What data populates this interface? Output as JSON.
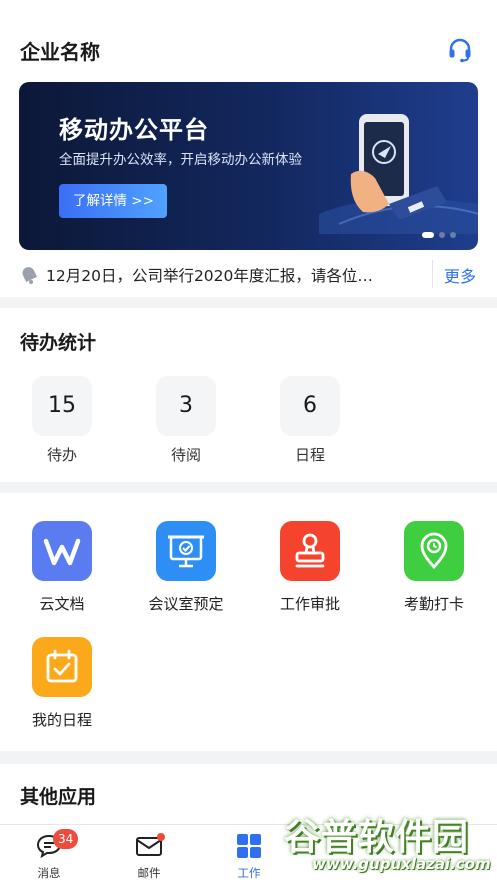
{
  "header": {
    "title": "企业名称",
    "support_icon": "headset-icon"
  },
  "banner": {
    "title": "移动办公平台",
    "subtitle": "全面提升办公效率，开启移动办公新体验",
    "button_label": "了解详情 >>",
    "slide_count": 3,
    "active_slide": 1
  },
  "notice": {
    "text": "12月20日，公司举行2020年度汇报，请各位…",
    "more_label": "更多",
    "icon": "bell-icon"
  },
  "todo": {
    "title": "待办统计",
    "items": [
      {
        "value": "15",
        "label": "待办"
      },
      {
        "value": "3",
        "label": "待阅"
      },
      {
        "value": "6",
        "label": "日程"
      }
    ]
  },
  "apps": [
    {
      "label": "云文档",
      "icon": "wps-icon",
      "color": "#5b7cf0"
    },
    {
      "label": "会议室预定",
      "icon": "meeting-room-icon",
      "color": "#2d8ff5"
    },
    {
      "label": "工作审批",
      "icon": "stamp-icon",
      "color": "#f5442d"
    },
    {
      "label": "考勤打卡",
      "icon": "location-clock-icon",
      "color": "#3fce3f"
    },
    {
      "label": "我的日程",
      "icon": "calendar-icon",
      "color": "#fba91b"
    }
  ],
  "other": {
    "title": "其他应用"
  },
  "tabbar": {
    "items": [
      {
        "label": "消息",
        "icon": "message-icon",
        "badge": "34"
      },
      {
        "label": "邮件",
        "icon": "mail-icon"
      },
      {
        "label": "工作",
        "icon": "grid-icon",
        "active": true
      }
    ]
  },
  "watermark": {
    "title": "谷普软件园",
    "url": "www.gupuxlazai.com"
  },
  "colors": {
    "accent": "#2f6ff0",
    "badge": "#f04b3d",
    "banner_bg": "#13285f"
  }
}
